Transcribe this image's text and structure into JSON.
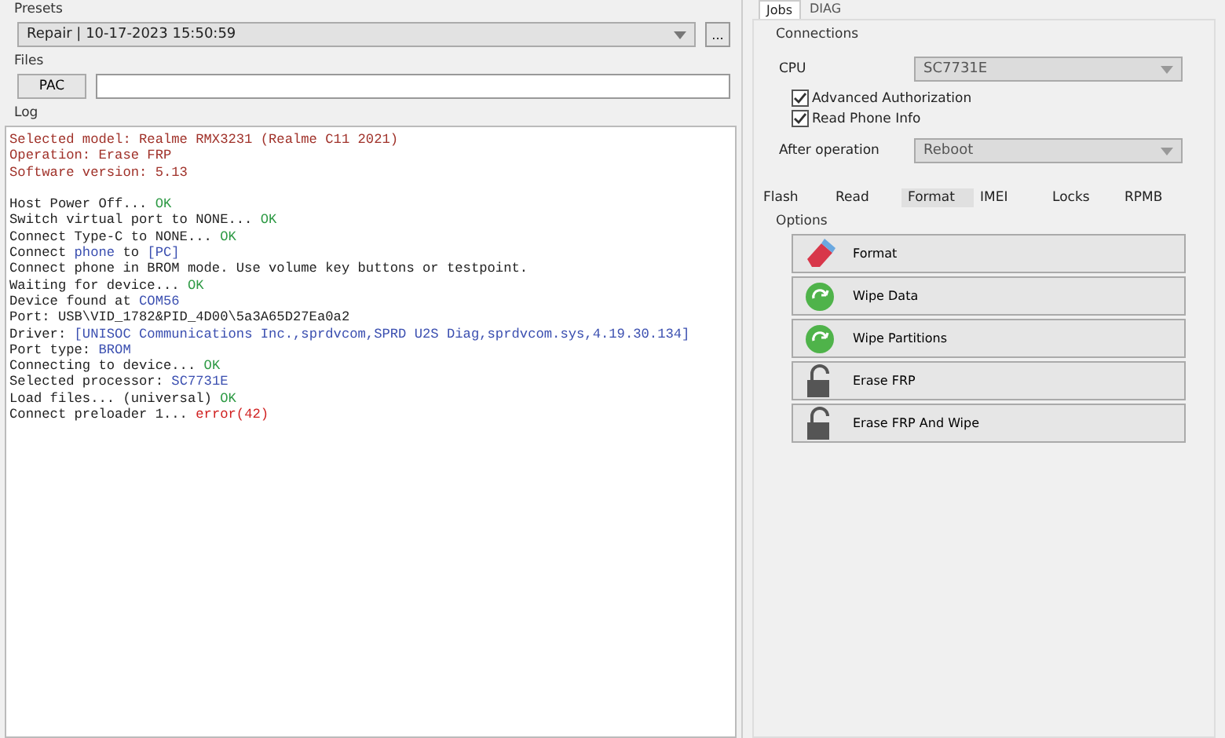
{
  "presets": {
    "label": "Presets",
    "value": "Repair | 10-17-2023 15:50:59",
    "button": "..."
  },
  "files": {
    "label": "Files",
    "button": "PAC"
  },
  "log": {
    "label": "Log",
    "lines": [
      {
        "kind": "text",
        "segments": [
          {
            "t": "Selected model: Realme RMX3231 (Realme C11 2021)",
            "kind": "title"
          }
        ]
      },
      {
        "kind": "text",
        "segments": [
          {
            "t": "Operation: Erase FRP",
            "kind": "title"
          }
        ]
      },
      {
        "kind": "text",
        "segments": [
          {
            "t": "Software version: 5.13",
            "kind": "title"
          }
        ]
      },
      {
        "kind": "blank"
      },
      {
        "kind": "text",
        "segments": [
          {
            "t": "Host Power Off... ",
            "kind": "plain"
          },
          {
            "t": "OK",
            "kind": "ok"
          }
        ]
      },
      {
        "kind": "text",
        "segments": [
          {
            "t": "Switch virtual port to NONE... ",
            "kind": "plain"
          },
          {
            "t": "OK",
            "kind": "ok"
          }
        ]
      },
      {
        "kind": "text",
        "segments": [
          {
            "t": "Connect Type-C to NONE... ",
            "kind": "plain"
          },
          {
            "t": "OK",
            "kind": "ok"
          }
        ]
      },
      {
        "kind": "text",
        "segments": [
          {
            "t": "Connect ",
            "kind": "plain"
          },
          {
            "t": "phone",
            "kind": "info"
          },
          {
            "t": " to ",
            "kind": "plain"
          },
          {
            "t": "[PC]",
            "kind": "info"
          }
        ]
      },
      {
        "kind": "text",
        "segments": [
          {
            "t": "Connect phone in BROM mode. Use volume key buttons or testpoint.",
            "kind": "plain"
          }
        ]
      },
      {
        "kind": "text",
        "segments": [
          {
            "t": "Waiting for device... ",
            "kind": "plain"
          },
          {
            "t": "OK",
            "kind": "ok"
          }
        ]
      },
      {
        "kind": "text",
        "segments": [
          {
            "t": "Device found at ",
            "kind": "plain"
          },
          {
            "t": "COM56",
            "kind": "info"
          }
        ]
      },
      {
        "kind": "text",
        "segments": [
          {
            "t": "Port: USB\\VID_1782&PID_4D00\\5a3A65D27Ea0a2",
            "kind": "plain"
          }
        ]
      },
      {
        "kind": "text",
        "segments": [
          {
            "t": "Driver: ",
            "kind": "plain"
          },
          {
            "t": "[UNISOC Communications Inc.,sprdvcom,SPRD U2S Diag,sprdvcom.sys,4.19.30.134]",
            "kind": "info"
          }
        ]
      },
      {
        "kind": "text",
        "segments": [
          {
            "t": "Port type: ",
            "kind": "plain"
          },
          {
            "t": "BROM",
            "kind": "info"
          }
        ]
      },
      {
        "kind": "text",
        "segments": [
          {
            "t": "Connecting to device... ",
            "kind": "plain"
          },
          {
            "t": "OK",
            "kind": "ok"
          }
        ]
      },
      {
        "kind": "text",
        "segments": [
          {
            "t": "Selected processor: ",
            "kind": "plain"
          },
          {
            "t": "SC7731E",
            "kind": "info"
          }
        ]
      },
      {
        "kind": "text",
        "segments": [
          {
            "t": "Load files... (universal) ",
            "kind": "plain"
          },
          {
            "t": "OK",
            "kind": "ok"
          }
        ]
      },
      {
        "kind": "text",
        "segments": [
          {
            "t": "Connect preloader 1... ",
            "kind": "plain"
          },
          {
            "t": "error(42)",
            "kind": "error"
          }
        ]
      }
    ]
  },
  "top_tabs": [
    {
      "label": "Jobs",
      "selected": true
    },
    {
      "label": "DIAG",
      "selected": false
    }
  ],
  "connections": {
    "label": "Connections",
    "cpu_label": "CPU",
    "cpu_value": "SC7731E",
    "checkboxes": [
      {
        "label": "Advanced Authorization",
        "checked": true
      },
      {
        "label": "Read Phone Info",
        "checked": true
      }
    ],
    "after_label": "After operation",
    "after_value": "Reboot"
  },
  "job_tabs": [
    {
      "label": "Flash",
      "selected": false
    },
    {
      "label": "Read",
      "selected": false
    },
    {
      "label": "Format",
      "selected": true
    },
    {
      "label": "IMEI",
      "selected": false
    },
    {
      "label": "Locks",
      "selected": false
    },
    {
      "label": "RPMB",
      "selected": false
    }
  ],
  "options": {
    "label": "Options",
    "buttons": [
      {
        "label": "Format",
        "kind": "format"
      },
      {
        "label": "Wipe Data",
        "kind": "wipe"
      },
      {
        "label": "Wipe Partitions",
        "kind": "wipe"
      },
      {
        "label": "Erase FRP",
        "kind": "unlock"
      },
      {
        "label": "Erase FRP And Wipe",
        "kind": "unlock"
      }
    ]
  }
}
